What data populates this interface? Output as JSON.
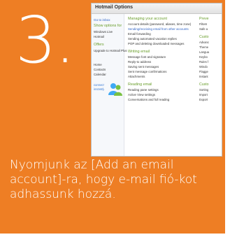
{
  "step": {
    "number": "3."
  },
  "screenshot": {
    "title": "Hotmail Options",
    "nav": {
      "links": [
        "Go to inbox"
      ],
      "show_options_for": "Show options for",
      "accounts": [
        "Windows Live",
        "Hotmail"
      ],
      "offers_heading": "Offers",
      "offers": [
        "Upgrade to Hotmail Plus"
      ],
      "bottom_links": [
        "Home",
        "Contacts",
        "Calendar"
      ],
      "connect": [
        "connect",
        "instantly"
      ]
    },
    "sections": [
      {
        "title": "Managing your account",
        "options": [
          "Account details (password, aliases, time zone)",
          "Sending/receiving email from other accounts",
          "Email forwarding",
          "Sending automated vacation replies",
          "POP and deleting downloaded messages"
        ]
      },
      {
        "title": "Writing email",
        "options": [
          "Message font and signature",
          "Reply-to address",
          "Saving sent messages",
          "Sent message confirmations",
          "Attachments"
        ]
      },
      {
        "title": "Reading email",
        "options": [
          "Reading pane settings",
          "Active View settings",
          "Conversations and full reading"
        ]
      }
    ],
    "col3": {
      "headers": [
        "Preve",
        "Custo",
        "Custo"
      ],
      "items_a": [
        "Filters",
        "Safe a"
      ],
      "items_b": [
        "Advanc",
        "Theme",
        "Langua",
        "Keybo",
        "Rules f",
        "Windo",
        "Flagge",
        "Instant"
      ],
      "items_c": [
        "Sorting",
        "Import",
        "Export"
      ]
    }
  },
  "caption": "Nyomjunk az [Add an email account]-ra, hogy e-mail fió-kot adhassunk hozzá.",
  "colors": {
    "card_background": "#ee7e24",
    "text_on_card": "#ffffff",
    "link_blue": "#2d62c4",
    "section_green": "#6a9e2c"
  }
}
